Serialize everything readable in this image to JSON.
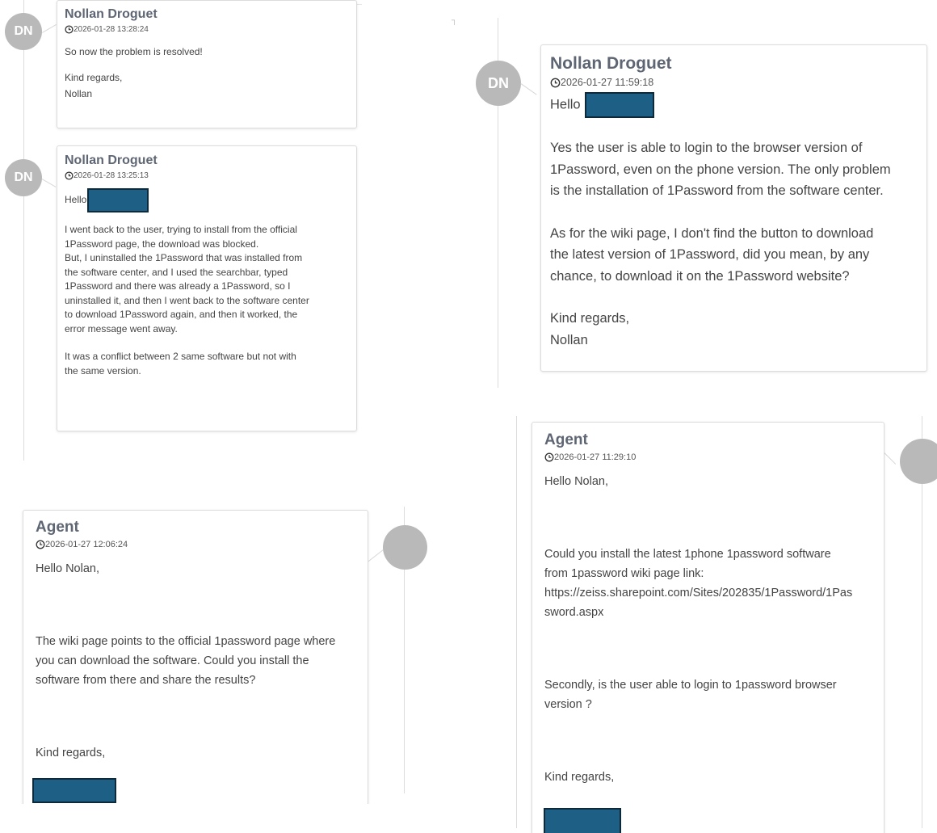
{
  "panels": {
    "top_left": {
      "messages": [
        {
          "author": "Nollan Droguet",
          "initials": "DN",
          "timestamp": "2026-01-28 13:28:24",
          "paragraphs": [
            "So now the problem is resolved!",
            "Kind regards,",
            "Nollan"
          ]
        },
        {
          "author": "Nollan Droguet",
          "initials": "DN",
          "timestamp": "2026-01-28 13:25:13",
          "greeting": "Hello",
          "paragraphs": [
            "I went back to the user, trying to install from the official",
            "1Password page, the download was blocked.",
            "But, I uninstalled the 1Password that was installed from",
            "the software center, and I used the searchbar, typed",
            "1Password and there was already a 1Password, so I",
            "uninstalled it, and then I went back to the software center",
            "to download 1Password again, and then it worked, the",
            "error message went away.",
            "It was a conflict between 2 same software but not with",
            "the same version."
          ]
        }
      ]
    },
    "top_right": {
      "message": {
        "author": "Nollan Droguet",
        "initials": "DN",
        "timestamp": "2026-01-27 11:59:18",
        "greeting": "Hello",
        "paragraphs": [
          "Yes the user is able to login to the browser version of",
          "1Password, even on the phone version. The only problem",
          "is the installation of 1Password from the software center.",
          "As for the wiki page, I don't find the button to download",
          "the latest version of 1Password, did you mean, by any",
          "chance, to download it on the 1Password website?",
          "Kind regards,",
          "Nollan"
        ]
      }
    },
    "bottom_left": {
      "message": {
        "author": "Agent",
        "timestamp": "2026-01-27 12:06:24",
        "paragraphs": [
          "Hello Nolan,",
          "The wiki page points to the official 1password page where",
          "you can download the software. Could you install the",
          "software from there and share the results?",
          "Kind regards,"
        ]
      }
    },
    "bottom_right": {
      "message": {
        "author": "Agent",
        "timestamp": "2026-01-27 11:29:10",
        "paragraphs": [
          "Hello Nolan,",
          "Could you install the latest 1phone 1password software",
          "from 1password wiki page link:",
          "https://zeiss.sharepoint.com/Sites/202835/1Password/1Pas",
          "sword.aspx",
          "Secondly, is the user able to login to 1password browser",
          "version ?",
          "Kind regards,"
        ]
      }
    }
  },
  "colors": {
    "author": "#5f6673",
    "avatar": "#b9b9b9",
    "redaction": "#1d5f85",
    "timeline": "#dcdcdc"
  },
  "icons": {
    "timestamp": "clock-icon"
  }
}
